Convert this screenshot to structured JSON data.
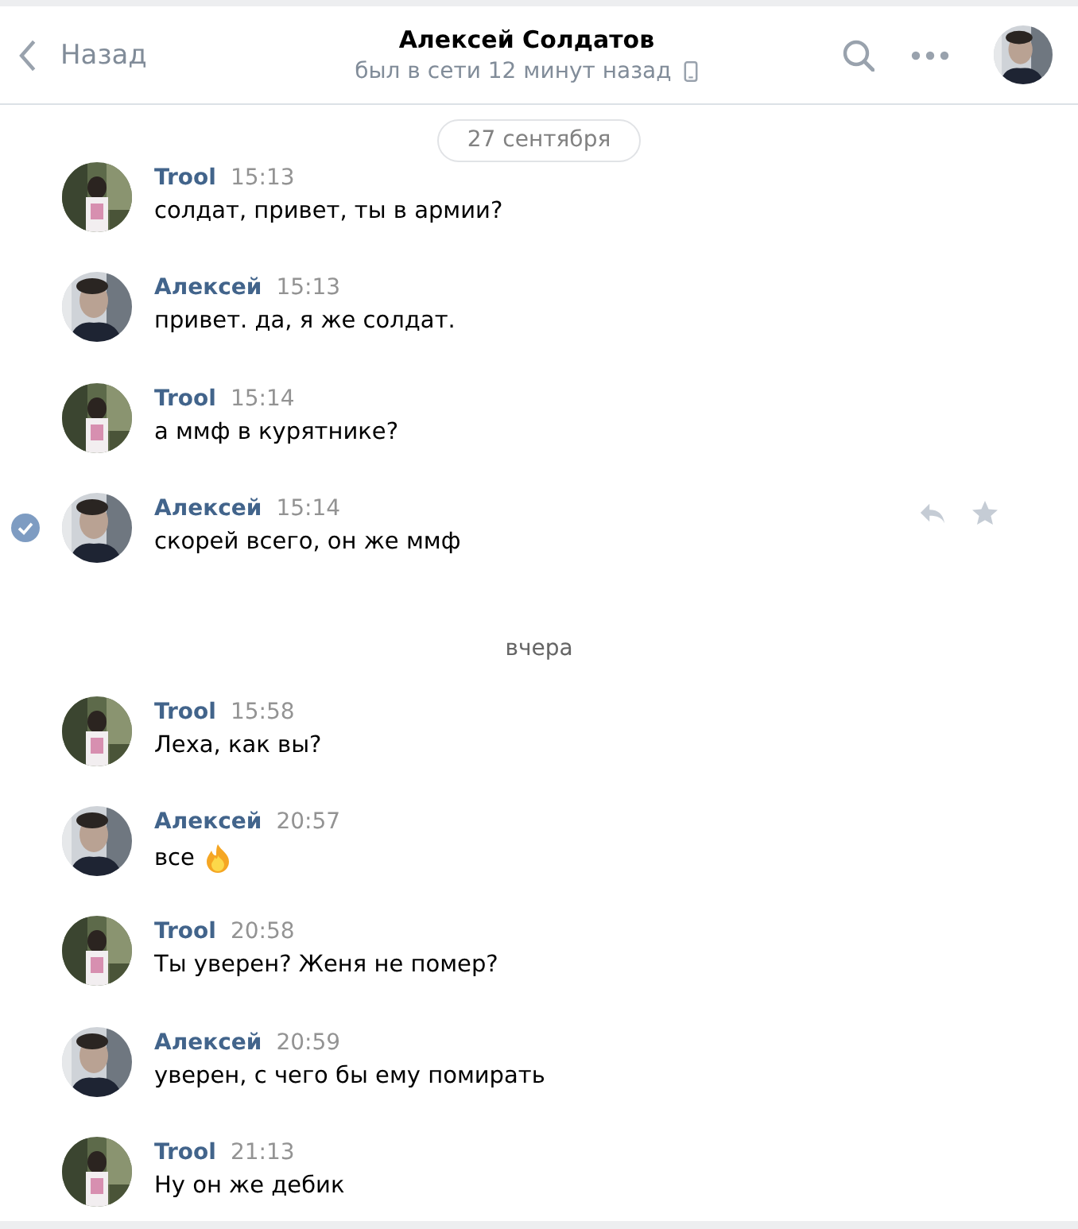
{
  "header": {
    "back": "Назад",
    "title": "Алексей Солдатов",
    "status": "был в сети 12 минут назад",
    "mobile": true
  },
  "date_pill": "27 сентября",
  "feed": [
    {
      "kind": "message",
      "author": "Trool",
      "time": "15:13",
      "text": "солдат, привет, ты в армии?",
      "selected": false
    },
    {
      "kind": "message",
      "author": "Алексей",
      "time": "15:13",
      "text": "привет. да, я же солдат.",
      "selected": false
    },
    {
      "kind": "message",
      "author": "Trool",
      "time": "15:14",
      "text": "а ммф в курятнике?",
      "selected": false
    },
    {
      "kind": "message",
      "author": "Алексей",
      "time": "15:14",
      "text": "скорей всего, он же ммф",
      "selected": true
    },
    {
      "kind": "separator",
      "text": "вчера"
    },
    {
      "kind": "message",
      "author": "Trool",
      "time": "15:58",
      "text": "Леха, как вы?",
      "selected": false
    },
    {
      "kind": "message",
      "author": "Алексей",
      "time": "20:57",
      "text": "все",
      "has_emoji": true,
      "selected": false
    },
    {
      "kind": "message",
      "author": "Trool",
      "time": "20:58",
      "text": "Ты уверен? Женя не помер?",
      "selected": false
    },
    {
      "kind": "message",
      "author": "Алексей",
      "time": "20:59",
      "text": "уверен, с чего бы ему помирать",
      "selected": false
    },
    {
      "kind": "message",
      "author": "Trool",
      "time": "21:13",
      "text": "Ну он же дебик",
      "selected": false
    }
  ]
}
